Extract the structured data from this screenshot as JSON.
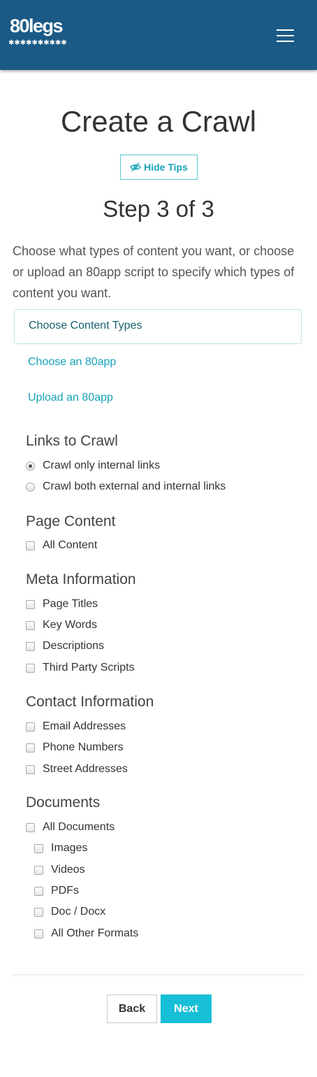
{
  "header": {
    "logo_text": "80legs",
    "logo_subtext": "✱✱✱✱✱✱✱✱✱✱",
    "menu_icon": "hamburger-menu-icon",
    "bg_color": "#1b5a86"
  },
  "page": {
    "title": "Create a Crawl",
    "hide_tips_label": "Hide Tips",
    "hide_tips_icon": "eye-slash-icon",
    "step_text": "Step 3 of 3",
    "intro": "Choose what types of content you want, or choose or upload an 80app script to specify which types of content you want."
  },
  "tabs": {
    "active": "Choose Content Types",
    "choose_app": "Choose an 80app",
    "upload_app": "Upload an 80app"
  },
  "sections": {
    "links": {
      "heading": "Links to Crawl",
      "options": [
        "Crawl only internal links",
        "Crawl both external and internal links"
      ],
      "selected": "Crawl only internal links"
    },
    "page_content": {
      "heading": "Page Content",
      "options": [
        "All Content"
      ]
    },
    "meta": {
      "heading": "Meta Information",
      "options": [
        "Page Titles",
        "Key Words",
        "Descriptions",
        "Third Party Scripts"
      ]
    },
    "contact": {
      "heading": "Contact Information",
      "options": [
        "Email Addresses",
        "Phone Numbers",
        "Street Addresses"
      ]
    },
    "documents": {
      "heading": "Documents",
      "all_label": "All Documents",
      "options": [
        "Images",
        "Videos",
        "PDFs",
        "Doc / Docx",
        "All Other Formats"
      ]
    }
  },
  "buttons": {
    "back": "Back",
    "next": "Next"
  },
  "colors": {
    "accent": "#17bfd6",
    "link": "#17a2b8"
  }
}
